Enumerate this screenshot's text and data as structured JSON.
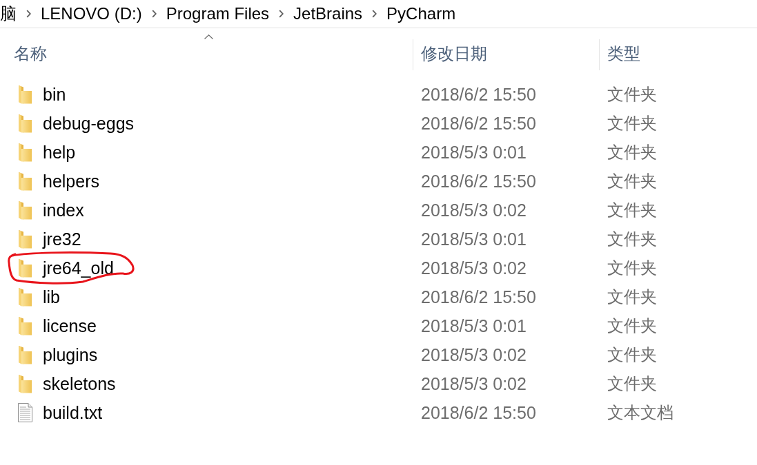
{
  "breadcrumb": [
    "脑",
    "LENOVO (D:)",
    "Program Files",
    "JetBrains",
    "PyCharm"
  ],
  "columns": [
    {
      "label": "名称",
      "sorted": true
    },
    {
      "label": "修改日期",
      "sorted": false
    },
    {
      "label": "类型",
      "sorted": false
    }
  ],
  "rows": [
    {
      "kind": "folder",
      "name": "bin",
      "modified": "2018/6/2 15:50",
      "type": "文件夹",
      "circled": false
    },
    {
      "kind": "folder",
      "name": "debug-eggs",
      "modified": "2018/6/2 15:50",
      "type": "文件夹",
      "circled": false
    },
    {
      "kind": "folder",
      "name": "help",
      "modified": "2018/5/3 0:01",
      "type": "文件夹",
      "circled": false
    },
    {
      "kind": "folder",
      "name": "helpers",
      "modified": "2018/6/2 15:50",
      "type": "文件夹",
      "circled": false
    },
    {
      "kind": "folder",
      "name": "index",
      "modified": "2018/5/3 0:02",
      "type": "文件夹",
      "circled": false
    },
    {
      "kind": "folder",
      "name": "jre32",
      "modified": "2018/5/3 0:01",
      "type": "文件夹",
      "circled": false
    },
    {
      "kind": "folder",
      "name": "jre64_old",
      "modified": "2018/5/3 0:02",
      "type": "文件夹",
      "circled": true
    },
    {
      "kind": "folder",
      "name": "lib",
      "modified": "2018/6/2 15:50",
      "type": "文件夹",
      "circled": false
    },
    {
      "kind": "folder",
      "name": "license",
      "modified": "2018/5/3 0:01",
      "type": "文件夹",
      "circled": false
    },
    {
      "kind": "folder",
      "name": "plugins",
      "modified": "2018/5/3 0:02",
      "type": "文件夹",
      "circled": false
    },
    {
      "kind": "folder",
      "name": "skeletons",
      "modified": "2018/5/3 0:02",
      "type": "文件夹",
      "circled": false
    },
    {
      "kind": "file",
      "name": "build.txt",
      "modified": "2018/6/2 15:50",
      "type": "文本文档",
      "circled": false
    }
  ]
}
